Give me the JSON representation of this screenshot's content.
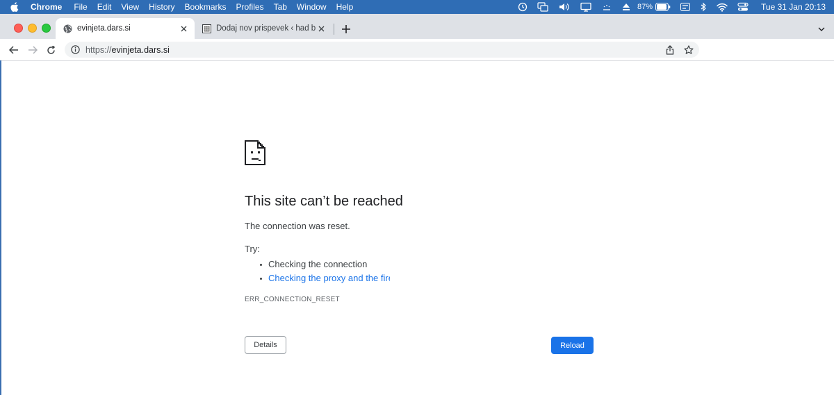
{
  "menubar": {
    "app_name": "Chrome",
    "items": [
      "File",
      "Edit",
      "View",
      "History",
      "Bookmarks",
      "Profiles",
      "Tab",
      "Window",
      "Help"
    ],
    "battery_percent": "87%",
    "clock": "Tue 31 Jan  20:13"
  },
  "tabs": [
    {
      "title": "evinjeta.dars.si",
      "favicon": "globe-icon",
      "active": true
    },
    {
      "title": "Dodaj nov prispevek ‹ had blog",
      "favicon": "site-favicon-icon",
      "active": false
    }
  ],
  "toolbar": {
    "url_scheme": "https://",
    "url_host": "evinjeta.dars.si"
  },
  "error_page": {
    "title": "This site can’t be reached",
    "message": "The connection was reset.",
    "try_label": "Try:",
    "suggestions": [
      "Checking the connection",
      "Checking the proxy and the firewall"
    ],
    "error_code": "ERR_CONNECTION_RESET",
    "details_label": "Details",
    "reload_label": "Reload"
  },
  "colors": {
    "menubar_bg": "#2f6db5",
    "tabstrip_bg": "#dee1e6",
    "link": "#1a73e8",
    "primary_button": "#1a73e8"
  }
}
